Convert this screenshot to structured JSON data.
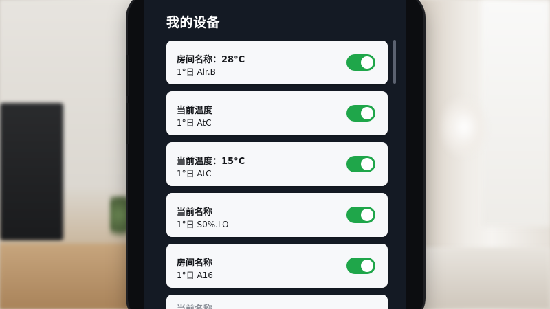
{
  "screen": {
    "title": "我的设备"
  },
  "devices": [
    {
      "line1": "房间名称：28°C",
      "line2": "1°日 Alr.B",
      "toggle_on": true
    },
    {
      "line1": "当前温度",
      "line2": "1°日 AtC",
      "toggle_on": true
    },
    {
      "line1": "当前温度：15°C",
      "line2": "1°日 AtC",
      "toggle_on": true
    },
    {
      "line1": "当前名称",
      "line2": "1°日 S0%.LO",
      "toggle_on": true
    },
    {
      "line1": "房间名称",
      "line2": "1°日 A16",
      "toggle_on": true
    },
    {
      "line1": "当前名称",
      "line2": "",
      "toggle_on": null
    }
  ],
  "colors": {
    "toggle_on": "#1fa64a",
    "screen_bg": "#141a24",
    "card_bg": "#f7f8fa"
  }
}
